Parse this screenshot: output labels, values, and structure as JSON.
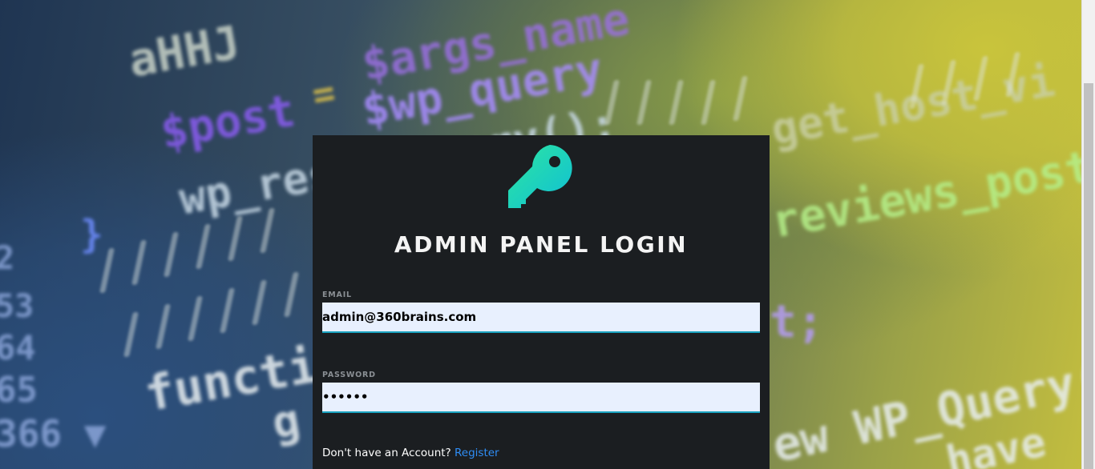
{
  "title": "ADMIN PANEL LOGIN",
  "email": {
    "label": "EMAIL",
    "value": "admin@360brains.com"
  },
  "password": {
    "label": "PASSWORD",
    "value": "123456"
  },
  "register": {
    "prompt": "Don't have an Account?",
    "link_label": "Register"
  },
  "icons": {
    "logo": "key-icon"
  },
  "colors": {
    "panel_bg": "#1b1e21",
    "input_bg": "#e8f0fe",
    "input_underline": "#1aa3c0",
    "link": "#2f8df5",
    "key_gradient_start": "#2ee6a0",
    "key_gradient_end": "#0fbfd6"
  }
}
